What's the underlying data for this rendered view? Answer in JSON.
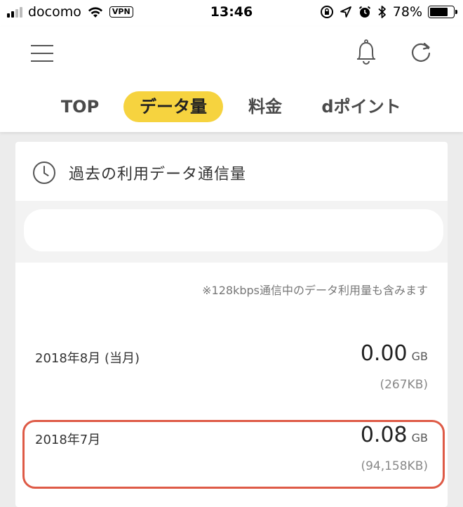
{
  "status_bar": {
    "carrier": "docomo",
    "vpn_label": "VPN",
    "time": "13:46",
    "battery_percent": "78%",
    "battery_level": 0.78,
    "icons": [
      "signal-bars-icon",
      "wifi-icon",
      "rotation-lock-icon",
      "location-arrow-icon",
      "alarm-icon",
      "bluetooth-icon",
      "battery-icon"
    ]
  },
  "header": {
    "icons": [
      "hamburger-menu-icon",
      "bell-icon",
      "refresh-icon"
    ],
    "tabs": [
      {
        "label": "TOP",
        "active": false
      },
      {
        "label": "データ量",
        "active": true
      },
      {
        "label": "料金",
        "active": false
      },
      {
        "label": "dポイント",
        "active": false
      }
    ],
    "accent_color": "#f6d33f"
  },
  "card": {
    "title": "過去の利用データ通信量",
    "title_icon": "clock-icon",
    "note": "※128kbps通信中のデータ利用量も含みます",
    "rows": [
      {
        "month": "2018年8月 (当月)",
        "value": "0.00",
        "unit": "GB",
        "kb": "(267KB)"
      },
      {
        "month": "2018年7月",
        "value": "0.08",
        "unit": "GB",
        "kb": "(94,158KB)"
      }
    ],
    "highlight_color": "#de5a46"
  }
}
